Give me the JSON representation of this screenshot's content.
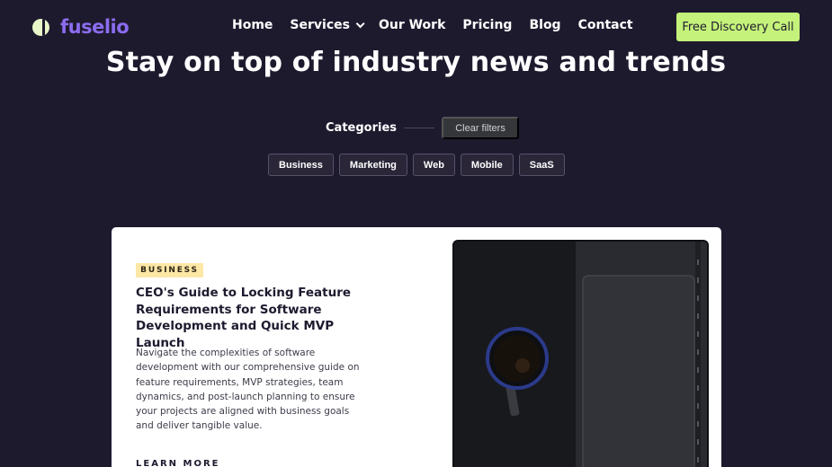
{
  "header": {
    "logo_text": "fuselio",
    "nav": [
      {
        "label": "Home"
      },
      {
        "label": "Services",
        "has_dropdown": true
      },
      {
        "label": "Our Work"
      },
      {
        "label": "Pricing"
      },
      {
        "label": "Blog"
      },
      {
        "label": "Contact"
      }
    ],
    "cta_label": "Free Discovery Call"
  },
  "hero": {
    "title": "Stay on top of industry news and trends"
  },
  "filters": {
    "label": "Categories",
    "clear_label": "Clear filters",
    "categories": [
      "Business",
      "Marketing",
      "Web",
      "Mobile",
      "SaaS"
    ]
  },
  "featured_post": {
    "badge": "BUSINESS",
    "title": "CEO's Guide to Locking Feature Requirements for Software Development and Quick MVP Launch",
    "description": "Navigate the complexities of software development with our comprehensive guide on feature requirements, MVP strategies, team dynamics, and post-launch planning to ensure your projects are aligned with business goals and deliver tangible value.",
    "link_label": "LEARN MORE"
  },
  "colors": {
    "background": "#1e1a2e",
    "brand": "#8b6cf0",
    "cta": "#c4f27a",
    "badge": "#fde7a6"
  }
}
